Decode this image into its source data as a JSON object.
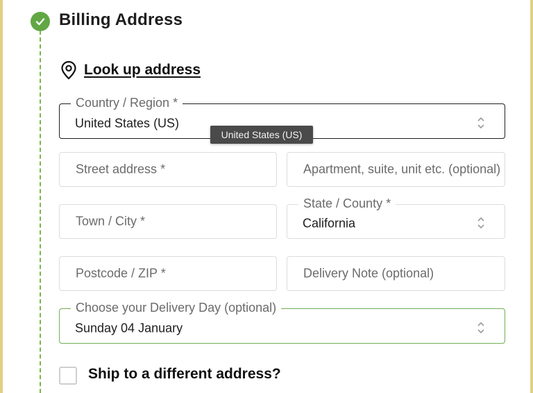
{
  "section": {
    "title": "Billing Address",
    "lookup_label": "Look up address"
  },
  "fields": {
    "country": {
      "label": "Country / Region *",
      "value": "United States (US)",
      "tooltip": "United States (US)"
    },
    "street": {
      "placeholder": "Street address *"
    },
    "apartment": {
      "placeholder": "Apartment, suite, unit etc. (optional)"
    },
    "city": {
      "placeholder": "Town / City *"
    },
    "state": {
      "label": "State / County *",
      "value": "California"
    },
    "postcode": {
      "placeholder": "Postcode / ZIP *"
    },
    "delivery_note": {
      "placeholder": "Delivery Note (optional)"
    },
    "delivery_day": {
      "label": "Choose your Delivery Day (optional)",
      "value": "Sunday 04 January"
    }
  },
  "ship_different": {
    "label": "Ship to a different address?",
    "checked": false
  },
  "colors": {
    "accent_green": "#62a744",
    "frame_gold": "#e2cf85",
    "tooltip_bg": "#4a4a4a"
  },
  "icons": [
    "check-icon",
    "location-pin-icon",
    "select-arrows-icon"
  ]
}
